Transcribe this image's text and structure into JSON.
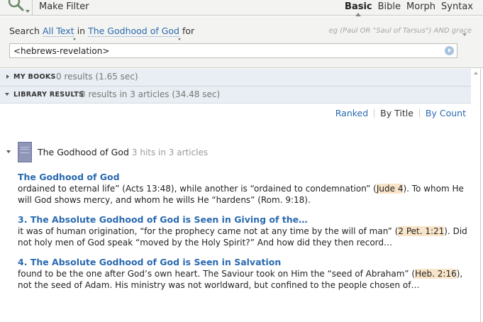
{
  "toolbar": {
    "make_filter_label": "Make Filter",
    "modes": [
      {
        "label": "Basic",
        "active": true
      },
      {
        "label": "Bible",
        "active": false
      },
      {
        "label": "Morph",
        "active": false
      },
      {
        "label": "Syntax",
        "active": false
      }
    ]
  },
  "search": {
    "prefix": "Search",
    "scope_label": "All Text",
    "in_label": "in",
    "resource_label": "The Godhood of God",
    "for_label": "for",
    "example_text": "eg (Paul OR \"Saul of Tarsus\") AND grace",
    "query_value": "<hebrews-revelation>"
  },
  "sections": {
    "my_books": {
      "title": "MY BOOKS",
      "info": "0 results (1.65 sec)"
    },
    "library": {
      "title": "LIBRARY RESULTS",
      "info": "3 results in 3 articles (34.48 sec)"
    }
  },
  "sort": {
    "ranked": "Ranked",
    "by_title": "By Title",
    "by_count": "By Count",
    "active": "By Title"
  },
  "book": {
    "title": "The Godhood of God",
    "hits": "3 hits in 3 articles"
  },
  "results": [
    {
      "title": "The Godhood of God",
      "text_before": "ordained to eternal life” (Acts 13:48), while another is “ordained to condemnation” (",
      "ref": "Jude 4",
      "text_after": "). To whom He will God shows mercy, and whom he wills He “hardens” (Rom. 9:18)."
    },
    {
      "title": "3. The Absolute Godhood of God is Seen in Giving of the…",
      "text_before": "it was of human origination, “for the prophecy came not at any time by the will of man” (",
      "ref": "2 Pet. 1:21",
      "text_after": "). Did not holy men of God speak “moved by the Holy Spirit?” And how did they then record…"
    },
    {
      "title": "4. The Absolute Godhood of God is Seen in Salvation",
      "text_before": "found to be the one after God’s own heart. The Saviour took on Him the “seed of Abraham” (",
      "ref": "Heb. 2:16",
      "text_after": "), not the seed of Adam. His ministry was not worldward, but confined to the people chosen of…"
    }
  ],
  "colors": {
    "link": "#2a6ab0",
    "highlight": "#f8e4c8",
    "section_bg": "#e8eef3",
    "panel_bg": "#f3f3f1"
  }
}
